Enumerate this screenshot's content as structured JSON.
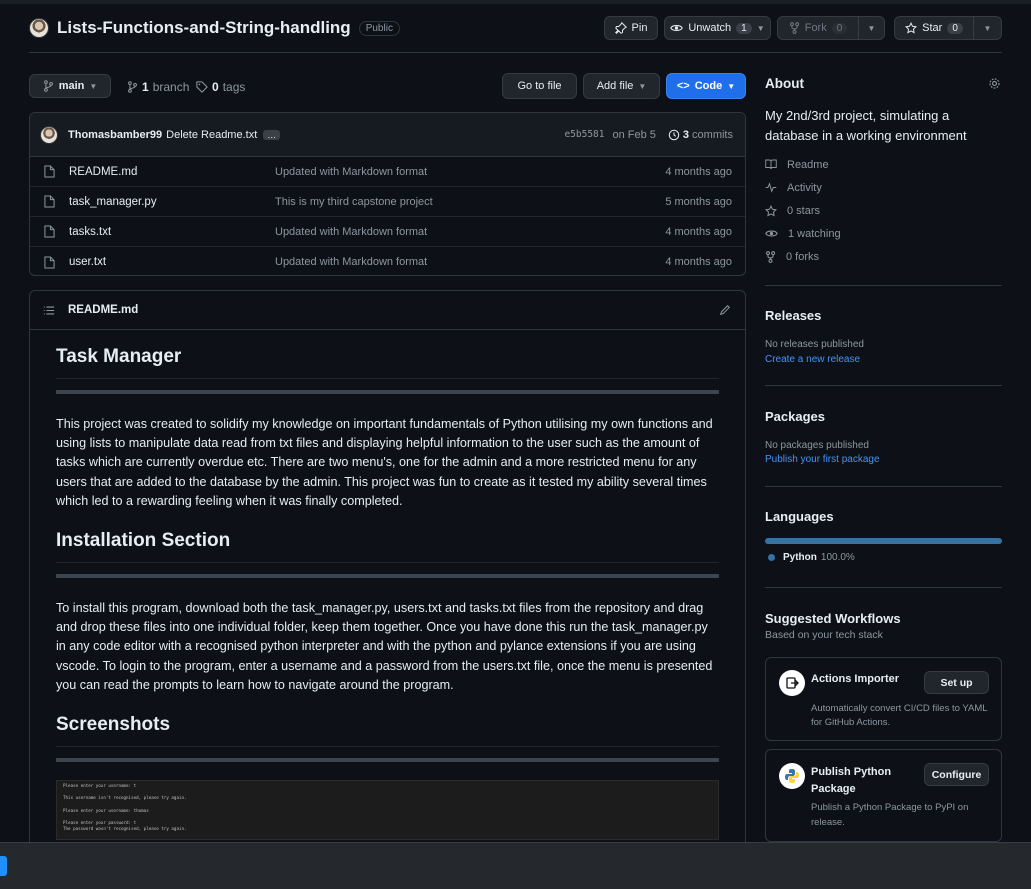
{
  "repo": {
    "name": "Lists-Functions-and-String-handling",
    "visibility": "Public",
    "pin_label": "Pin",
    "unwatch_label": "Unwatch",
    "watch_count": "1",
    "fork_label": "Fork",
    "fork_count": "0",
    "star_label": "Star",
    "star_count": "0"
  },
  "toolbar": {
    "branch": "main",
    "branches_count": "1",
    "branches_label": "branch",
    "tags_count": "0",
    "tags_label": "tags",
    "go_to_file": "Go to file",
    "add_file": "Add file",
    "code": "Code"
  },
  "commit": {
    "author": "Thomasbamber99",
    "message": "Delete Readme.txt",
    "ellipsis": "…",
    "sha": "e5b5581",
    "date": "on Feb 5",
    "commits_count": "3",
    "commits_label": "commits"
  },
  "files": [
    {
      "name": "README.md",
      "message": "Updated with Markdown format",
      "age": "4 months ago"
    },
    {
      "name": "task_manager.py",
      "message": "This is my third capstone project",
      "age": "5 months ago"
    },
    {
      "name": "tasks.txt",
      "message": "Updated with Markdown format",
      "age": "4 months ago"
    },
    {
      "name": "user.txt",
      "message": "Updated with Markdown format",
      "age": "4 months ago"
    }
  ],
  "readme": {
    "filename": "README.md",
    "h1": "Task Manager",
    "p1": "This project was created to solidify my knowledge on important fundamentals of Python utilising my own functions and using lists to manipulate data read from txt files and displaying helpful information to the user such as the amount of tasks which are currently overdue etc. There are two menu's, one for the admin and a more restricted menu for any users that are added to the database by the admin. This project was fun to create as it tested my ability several times which led to a rewarding feeling when it was finally completed.",
    "h2": "Installation Section",
    "p2": "To install this program, download both the task_manager.py, users.txt and tasks.txt files from the repository and drag and drop these files into one individual folder, keep them together. Once you have done this run the task_manager.py in any code editor with a recognised python interpreter and with the python and pylance extensions if you are using vscode. To login to the program, enter a username and a password from the users.txt file, once the menu is presented you can read the prompts to learn how to navigate around the program.",
    "h3": "Screenshots",
    "terminal": [
      "Please enter your username: t",
      "",
      "This username isn't recognised, please try again.",
      "",
      "Please enter your username: thomas",
      "",
      "Please enter your password: t",
      "The password wasn't recognised, please try again."
    ]
  },
  "about": {
    "title": "About",
    "description": "My 2nd/3rd project, simulating a database in a working environment",
    "readme": "Readme",
    "activity": "Activity",
    "stars": "0 stars",
    "watching": "1 watching",
    "forks": "0 forks"
  },
  "releases": {
    "title": "Releases",
    "none": "No releases published",
    "link": "Create a new release"
  },
  "packages": {
    "title": "Packages",
    "none": "No packages published",
    "link": "Publish your first package"
  },
  "languages": {
    "title": "Languages",
    "items": [
      {
        "name": "Python",
        "percent": "100.0%",
        "share": 1.0,
        "color": "#3572A5"
      }
    ]
  },
  "workflows": {
    "title": "Suggested Workflows",
    "subtitle": "Based on your tech stack",
    "items": [
      {
        "name": "Actions Importer",
        "button": "Set up",
        "desc": "Automatically convert CI/CD files to YAML for GitHub Actions."
      },
      {
        "name": "Publish Python Package",
        "button": "Configure",
        "desc": "Publish a Python Package to PyPI on release."
      }
    ]
  },
  "colors": {
    "accent": "#1f6feb",
    "link": "#4493f8",
    "background": "#0d1117"
  }
}
